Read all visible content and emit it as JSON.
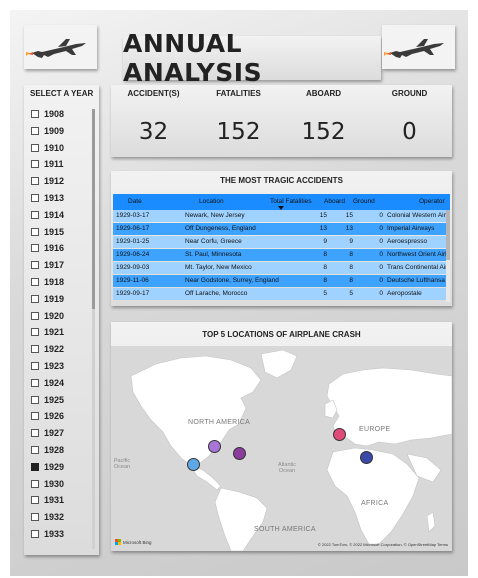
{
  "title": "ANNUAL ANALYSIS",
  "logos": [
    {
      "icon": "fighter-jet-icon"
    },
    {
      "icon": "fighter-jet-icon"
    }
  ],
  "slicer": {
    "title": "SELECT A YEAR",
    "years": [
      {
        "label": "1908",
        "checked": false
      },
      {
        "label": "1909",
        "checked": false
      },
      {
        "label": "1910",
        "checked": false
      },
      {
        "label": "1911",
        "checked": false
      },
      {
        "label": "1912",
        "checked": false
      },
      {
        "label": "1913",
        "checked": false
      },
      {
        "label": "1914",
        "checked": false
      },
      {
        "label": "1915",
        "checked": false
      },
      {
        "label": "1916",
        "checked": false
      },
      {
        "label": "1917",
        "checked": false
      },
      {
        "label": "1918",
        "checked": false
      },
      {
        "label": "1919",
        "checked": false
      },
      {
        "label": "1920",
        "checked": false
      },
      {
        "label": "1921",
        "checked": false
      },
      {
        "label": "1922",
        "checked": false
      },
      {
        "label": "1923",
        "checked": false
      },
      {
        "label": "1924",
        "checked": false
      },
      {
        "label": "1925",
        "checked": false
      },
      {
        "label": "1926",
        "checked": false
      },
      {
        "label": "1927",
        "checked": false
      },
      {
        "label": "1928",
        "checked": false
      },
      {
        "label": "1929",
        "checked": true
      },
      {
        "label": "1930",
        "checked": false
      },
      {
        "label": "1931",
        "checked": false
      },
      {
        "label": "1932",
        "checked": false
      },
      {
        "label": "1933",
        "checked": false
      }
    ]
  },
  "kpis": [
    {
      "label": "ACCIDENT(S)",
      "value": "32"
    },
    {
      "label": "FATALITIES",
      "value": "152"
    },
    {
      "label": "ABOARD",
      "value": "152"
    },
    {
      "label": "GROUND",
      "value": "0"
    }
  ],
  "table": {
    "title": "THE MOST TRAGIC ACCIDENTS",
    "columns": [
      "Date",
      "Location",
      "Total Fatalities",
      "Aboard",
      "Ground",
      "Operator"
    ],
    "sort_column": "Total Fatalities",
    "rows": [
      [
        "1929-03-17",
        "Newark, New Jersey",
        "15",
        "15",
        "0",
        "Colonial Western Airways"
      ],
      [
        "1929-06-17",
        "Off Dungeness, England",
        "13",
        "13",
        "0",
        "Imperial Airways"
      ],
      [
        "1929-01-25",
        "Near Corfu, Greece",
        "9",
        "9",
        "0",
        "Aeroespresso"
      ],
      [
        "1929-06-24",
        "St. Paul, Minnesota",
        "8",
        "8",
        "0",
        "Northwest Orient Airlines"
      ],
      [
        "1929-09-03",
        "Mt. Taylor, New Mexico",
        "8",
        "8",
        "0",
        "Trans Continental Air Transport"
      ],
      [
        "1929-11-06",
        "Near Godstone, Surrey, England",
        "8",
        "8",
        "0",
        "Deutsche Lufthansa"
      ],
      [
        "1929-09-17",
        "Off Larache, Morocco",
        "5",
        "5",
        "0",
        "Aeropostale"
      ]
    ]
  },
  "map": {
    "title": "TOP 5 LOCATIONS OF AIRPLANE CRASH",
    "labels": [
      "NORTH AMERICA",
      "EUROPE",
      "AFRICA",
      "SOUTH AMERICA"
    ],
    "ocean_labels": [
      "Pacific Ocean",
      "Atlantic Ocean"
    ],
    "copyright": "© 2022 TomTom, © 2022 Microsoft Corporation, © OpenStreetMap Terms",
    "bing_label": "Microsoft Bing",
    "markers": [
      {
        "name": "St. Paul, Minnesota",
        "color": "#a875d6"
      },
      {
        "name": "Newark, New Jersey",
        "color": "#8a3d9c"
      },
      {
        "name": "Mt. Taylor, New Mexico",
        "color": "#5fa8e8"
      },
      {
        "name": "Off Dungeness, England",
        "color": "#e04a7a"
      },
      {
        "name": "Near Corfu, Greece",
        "color": "#3b4aa8"
      }
    ]
  }
}
